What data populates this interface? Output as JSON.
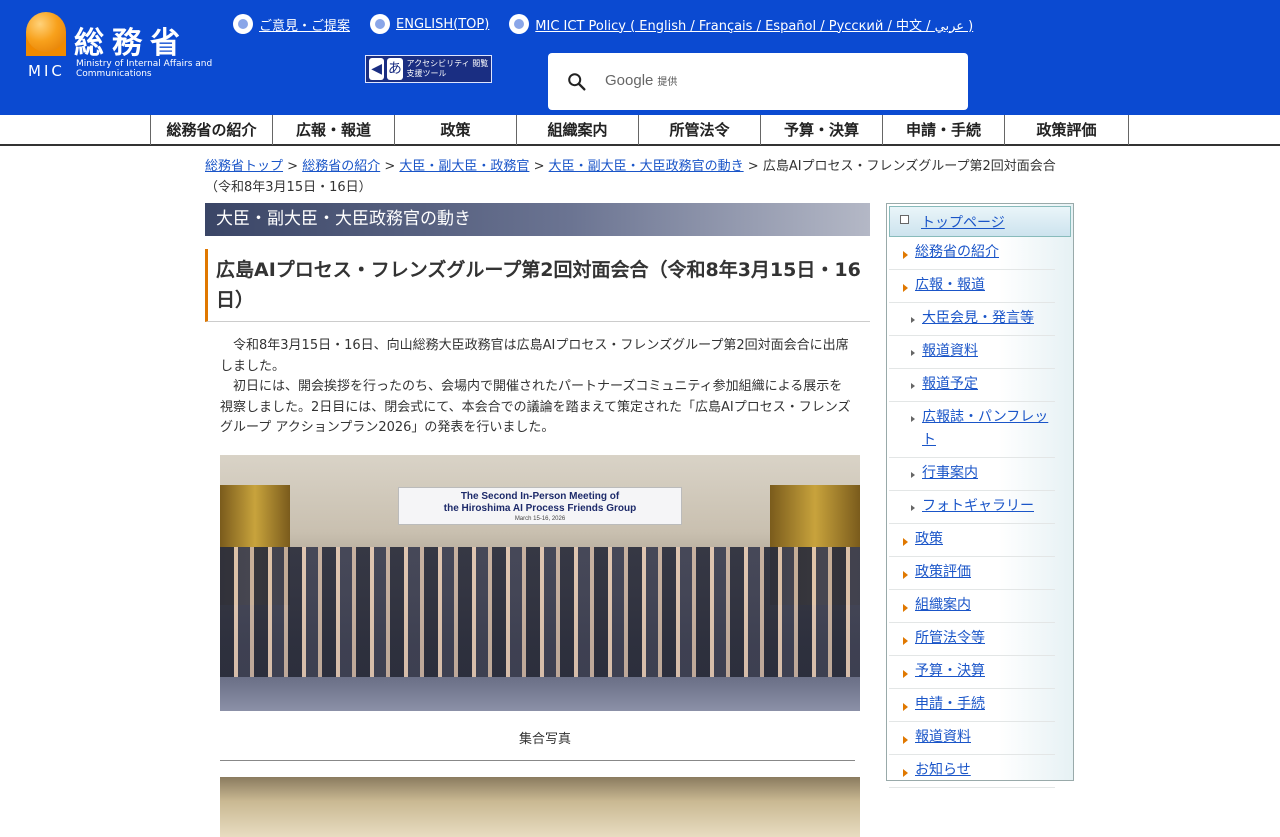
{
  "header": {
    "logo_kanji": "総務省",
    "logo_mic": "MIC",
    "logo_sub": "Ministry of Internal Affairs and Communications",
    "links": [
      {
        "label": "ご意見・ご提案"
      },
      {
        "label": "ENGLISH(TOP)"
      },
      {
        "label": "MIC ICT Policy ( English / Français / Español / Русский / 中文 / عربي )"
      }
    ],
    "accessibility_label": "アクセシビリティ 閲覧支援ツール",
    "search": {
      "brand": "Google",
      "suffix": "提供"
    }
  },
  "gnav": [
    "総務省の紹介",
    "広報・報道",
    "政策",
    "組織案内",
    "所管法令",
    "予算・決算",
    "申請・手続",
    "政策評価"
  ],
  "breadcrumb": {
    "items": [
      "総務省トップ",
      "総務省の紹介",
      "大臣・副大臣・政務官",
      "大臣・副大臣・大臣政務官の動き"
    ],
    "separator": ">",
    "current": "広島AIプロセス・フレンズグループ第2回対面会合（令和8年3月15日・16日）"
  },
  "main": {
    "section_head": "大臣・副大臣・大臣政務官の動き",
    "title": "広島AIプロセス・フレンズグループ第2回対面会合（令和8年3月15日・16日）",
    "paragraph1": "令和8年3月15日・16日、向山総務大臣政務官は広島AIプロセス・フレンズグループ第2回対面会合に出席しました。",
    "paragraph2": "初日には、開会挨拶を行ったのち、会場内で開催されたパートナーズコミュニティ参加組織による展示を視察しました。2日目には、閉会式にて、本会合での議論を踏まえて策定された「広島AIプロセス・フレンズグループ アクションプラン2026」の発表を行いました。",
    "photo_banner_line1": "The Second In-Person Meeting of",
    "photo_banner_line2": "the Hiroshima AI Process Friends Group",
    "photo_banner_date": "March 15-16, 2026",
    "caption": "集合写真"
  },
  "sidenav": {
    "top": "トップページ",
    "items": [
      {
        "label": "総務省の紹介",
        "level": 1
      },
      {
        "label": "広報・報道",
        "level": 1
      },
      {
        "label": "大臣会見・発言等",
        "level": 2
      },
      {
        "label": "報道資料",
        "level": 2
      },
      {
        "label": "報道予定",
        "level": 2
      },
      {
        "label": "広報誌・パンフレット",
        "level": 2
      },
      {
        "label": "行事案内",
        "level": 2
      },
      {
        "label": "フォトギャラリー",
        "level": 2
      },
      {
        "label": "政策",
        "level": 1
      },
      {
        "label": "政策評価",
        "level": 1
      },
      {
        "label": "組織案内",
        "level": 1
      },
      {
        "label": "所管法令等",
        "level": 1
      },
      {
        "label": "予算・決算",
        "level": 1
      },
      {
        "label": "申請・手続",
        "level": 1
      },
      {
        "label": "報道資料",
        "level": 1
      },
      {
        "label": "お知らせ",
        "level": 1
      }
    ]
  },
  "colors": {
    "header_bg": "#0b4ad1",
    "accent": "#e07800",
    "link": "#1a55c8"
  }
}
